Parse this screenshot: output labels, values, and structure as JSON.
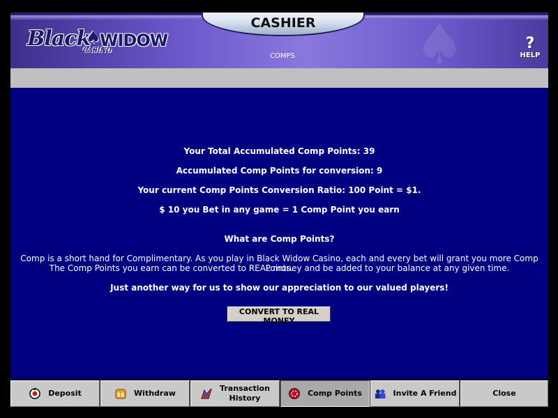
{
  "header": {
    "title": "CASHIER",
    "subtitle": "COMPS",
    "help_label": "HELP",
    "help_symbol": "?",
    "logo": {
      "black": "Black",
      "widow": "WIDOW",
      "casino": "CASINO"
    }
  },
  "main": {
    "total_points": "Your Total Accumulated Comp Points: 39",
    "conversion_points": "Accumulated Comp Points for conversion: 9",
    "ratio": "Your current Comp Points Conversion Ratio: 100 Point = $1.",
    "earn_rule": "$ 10 you Bet in any game = 1 Comp Point you earn",
    "what_heading": "What are Comp Points?",
    "description_1": "Comp is a short hand for Complimentary. As you play in Black Widow Casino, each and every bet will grant you more Comp Points.",
    "description_2": "The Comp Points you earn can be converted to REAL money and be added to your balance at any given time.",
    "appreciation": "Just another way for us to show our appreciation to our valued players!",
    "convert_button": "CONVERT TO REAL MONEY"
  },
  "tabs": [
    {
      "label": "Deposit",
      "icon": "deposit-icon"
    },
    {
      "label": "Withdraw",
      "icon": "withdraw-icon"
    },
    {
      "label_line1": "Transaction",
      "label_line2": "History",
      "icon": "transaction-history-icon"
    },
    {
      "label": "Comp Points",
      "icon": "comp-points-icon",
      "active": true
    },
    {
      "label": "Invite A Friend",
      "icon": "invite-friend-icon"
    },
    {
      "label": "Close"
    }
  ],
  "colors": {
    "main_bg": "#000080",
    "header_purple": "#6a56c8",
    "grey_bar": "#c0c0c0",
    "tab_bg": "#c9c9c9"
  }
}
